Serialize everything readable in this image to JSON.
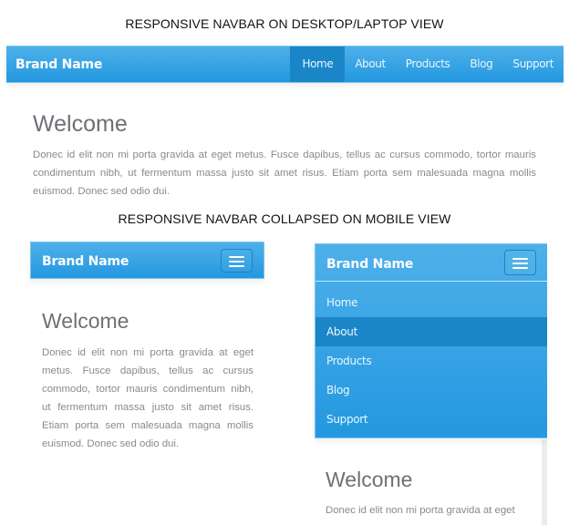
{
  "captions": {
    "desktop": "RESPONSIVE NAVBAR ON DESKTOP/LAPTOP VIEW",
    "mobile": "RESPONSIVE NAVBAR COLLAPSED ON MOBILE VIEW"
  },
  "brand": "Brand Name",
  "nav_items": [
    {
      "label": "Home",
      "active_desktop": true
    },
    {
      "label": "About",
      "active_mobile": true
    },
    {
      "label": "Products"
    },
    {
      "label": "Blog"
    },
    {
      "label": "Support"
    }
  ],
  "toggle_icon": "hamburger-menu-icon",
  "content": {
    "heading": "Welcome",
    "body": "Donec id elit non mi porta gravida at eget metus. Fusce dapibus, tellus ac cursus commodo, tortor mauris condimentum nibh, ut fermentum massa justo sit amet risus. Etiam porta sem malesuada magna mollis euismod. Donec sed odio dui.",
    "body_truncated": "Donec id elit non mi porta gravida at eget"
  },
  "colors": {
    "navbar_top": "#4eb0e9",
    "navbar_bottom": "#2398e0",
    "active_item": "#1a86c8",
    "heading": "#6f7077",
    "body_text": "#8a8a8a"
  }
}
